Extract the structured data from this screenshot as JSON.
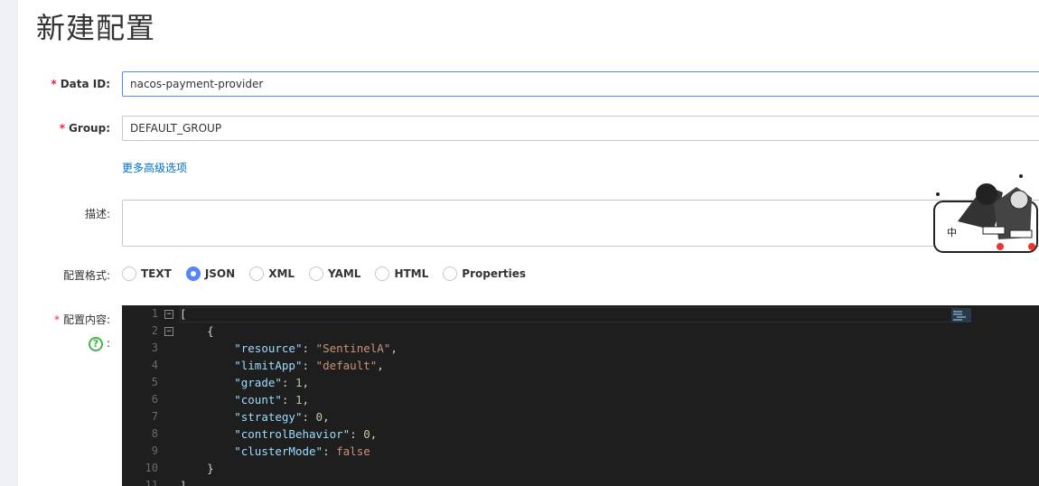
{
  "page": {
    "title": "新建配置"
  },
  "form": {
    "data_id": {
      "required_mark": "*",
      "label": "Data ID:",
      "value": "nacos-payment-provider"
    },
    "group": {
      "required_mark": "*",
      "label": "Group:",
      "value": "DEFAULT_GROUP"
    },
    "advanced_link": "更多高级选项",
    "description": {
      "label": "描述:",
      "value": ""
    },
    "format": {
      "label": "配置格式:",
      "options": [
        {
          "label": "TEXT",
          "checked": false
        },
        {
          "label": "JSON",
          "checked": true
        },
        {
          "label": "XML",
          "checked": false
        },
        {
          "label": "YAML",
          "checked": false
        },
        {
          "label": "HTML",
          "checked": false
        },
        {
          "label": "Properties",
          "checked": false
        }
      ]
    },
    "content": {
      "required_mark": "*",
      "label": "配置内容:",
      "help_icon": "question-circle-icon",
      "help_colon": ":"
    }
  },
  "editor": {
    "line_numbers": [
      "1",
      "2",
      "3",
      "4",
      "5",
      "6",
      "7",
      "8",
      "9",
      "10",
      "11"
    ],
    "lines": [
      "[",
      "    {",
      "        \"resource\": \"SentinelA\",",
      "        \"limitApp\": \"default\",",
      "        \"grade\": 1,",
      "        \"count\": 1,",
      "        \"strategy\": 0,",
      "        \"controlBehavior\": 0,",
      "        \"clusterMode\": false",
      "    }",
      "]"
    ],
    "fold_markers": [
      "−",
      "−"
    ]
  },
  "decor": {
    "sticker_text": "中"
  }
}
